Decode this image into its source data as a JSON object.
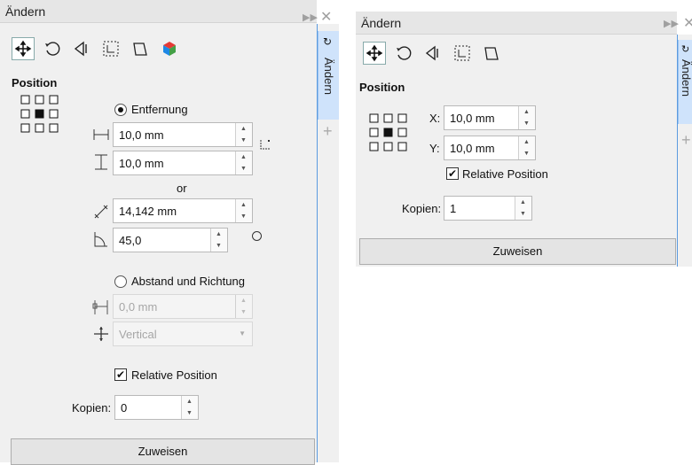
{
  "left": {
    "title": "Ändern",
    "section": "Position",
    "radio_distance": "Entfernung",
    "h_value": "10,0 mm",
    "v_value": "10,0 mm",
    "or_label": "or",
    "diag_value": "14,142 mm",
    "angle_value": "45,0",
    "radio_direction": "Abstand und Richtung",
    "dir_value": "0,0 mm",
    "dir_mode": "Vertical",
    "relative_label": "Relative Position",
    "copies_label": "Kopien:",
    "copies_value": "0",
    "apply": "Zuweisen",
    "tab": "Ändern"
  },
  "right": {
    "title": "Ändern",
    "section": "Position",
    "x_label": "X:",
    "x_value": "10,0 mm",
    "y_label": "Y:",
    "y_value": "10,0 mm",
    "relative_label": "Relative Position",
    "copies_label": "Kopien:",
    "copies_value": "1",
    "apply": "Zuweisen",
    "tab": "Ändern"
  },
  "icons": [
    "position-tool-icon",
    "rotate-icon",
    "scale-icon",
    "size-icon",
    "skew-icon",
    "3d-cube-icon",
    "expand-icon",
    "close-icon",
    "anchor-grid-icon",
    "add-icon"
  ]
}
